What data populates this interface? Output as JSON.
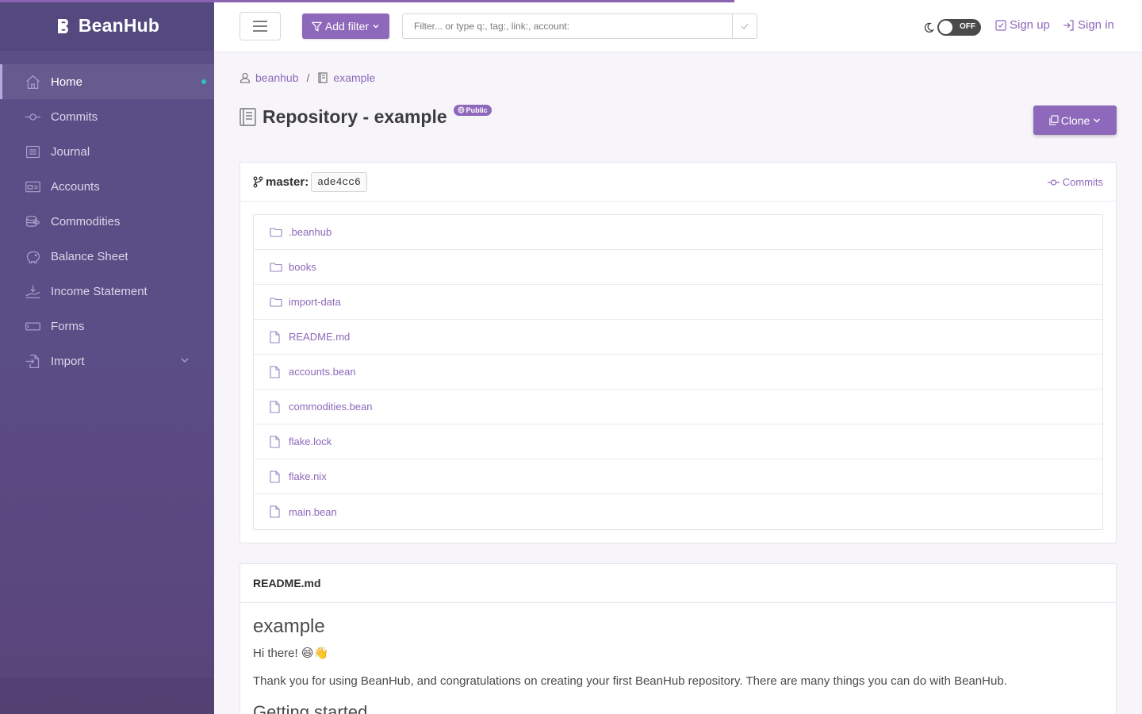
{
  "brand": {
    "name": "BeanHub"
  },
  "sidebar": {
    "items": [
      {
        "label": "Home",
        "icon": "home-icon"
      },
      {
        "label": "Commits",
        "icon": "commit-icon"
      },
      {
        "label": "Journal",
        "icon": "journal-icon"
      },
      {
        "label": "Accounts",
        "icon": "accounts-icon"
      },
      {
        "label": "Commodities",
        "icon": "coins-icon"
      },
      {
        "label": "Balance Sheet",
        "icon": "piggy-bank-icon"
      },
      {
        "label": "Income Statement",
        "icon": "income-icon"
      },
      {
        "label": "Forms",
        "icon": "form-icon"
      },
      {
        "label": "Import",
        "icon": "import-icon"
      }
    ]
  },
  "topbar": {
    "add_filter_label": "Add filter",
    "search_placeholder": "Filter... or type q:, tag:, link:, account:",
    "toggle_label": "OFF",
    "signup_label": "Sign up",
    "signin_label": "Sign in"
  },
  "breadcrumb": {
    "owner": "beanhub",
    "repo": "example",
    "separator": "/"
  },
  "page": {
    "title": "Repository - example",
    "badge": "Public",
    "clone_label": "Clone"
  },
  "repo": {
    "branch": "master:",
    "commit_hash": "ade4cc6",
    "commits_label": "Commits",
    "files": [
      {
        "name": ".beanhub",
        "type": "folder"
      },
      {
        "name": "books",
        "type": "folder"
      },
      {
        "name": "import-data",
        "type": "folder"
      },
      {
        "name": "README.md",
        "type": "file"
      },
      {
        "name": "accounts.bean",
        "type": "file"
      },
      {
        "name": "commodities.bean",
        "type": "file"
      },
      {
        "name": "flake.lock",
        "type": "file"
      },
      {
        "name": "flake.nix",
        "type": "file"
      },
      {
        "name": "main.bean",
        "type": "file"
      }
    ]
  },
  "readme": {
    "header": "README.md",
    "heading": "example",
    "greeting": "Hi there! 😄👋",
    "intro": "Thank you for using BeanHub, and congratulations on creating your first BeanHub repository. There are many things you can do with BeanHub.",
    "subheading": "Getting started"
  },
  "colors": {
    "accent": "#8e68ba",
    "sidebar": "#5a4e86",
    "active_dot": "#2ec4b6"
  }
}
